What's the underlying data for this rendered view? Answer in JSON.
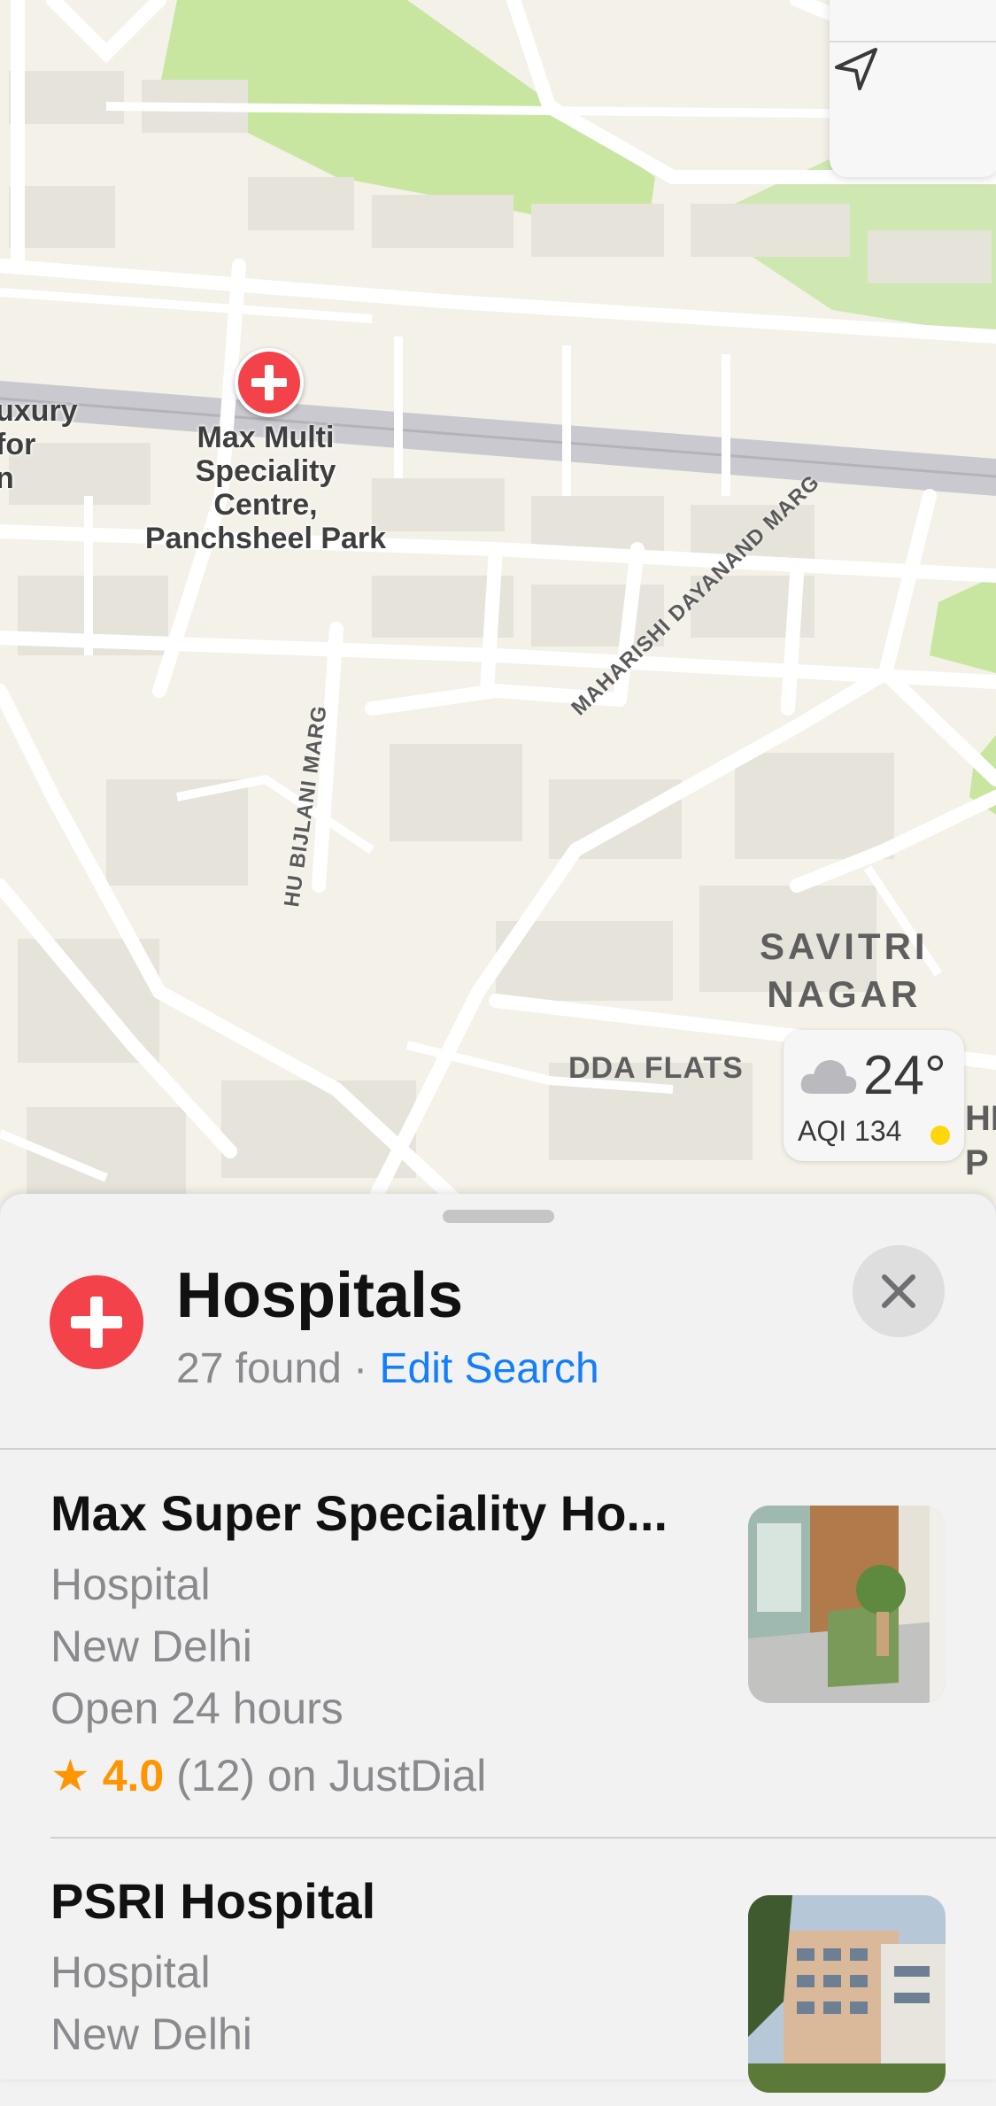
{
  "map": {
    "poi_name": "Max Multi\nSpeciality\nCentre,\nPanchsheel Park",
    "left_partial_label": "uxury\nfor\nn",
    "roads": {
      "road_1": "MAHARISHI DAYANAND MARG",
      "road_2": "HU BIJLANI MARG"
    },
    "area": {
      "savitri_nagar": "SAVITRI\nNAGAR",
      "dda_flats": "DDA FLATS",
      "edge_partial": "HE\nP"
    },
    "colors": {
      "land": "#f4f1e8",
      "park": "#c8e6a0",
      "road": "#ffffff",
      "building": "#e4e1da",
      "highway": "#c9c9cf"
    }
  },
  "controls": {
    "location_icon": "location-arrow-icon"
  },
  "weather": {
    "icon": "cloud-icon",
    "temperature": "24°",
    "aqi_label": "AQI 134",
    "aqi_dot_color": "#ffd60a"
  },
  "sheet": {
    "title": "Hospitals",
    "count_text": "27 found",
    "separator": " · ",
    "edit_search": "Edit Search",
    "category_icon": "hospital-cross-icon",
    "close_icon": "close-icon",
    "accent": "#147efb",
    "brand_red": "#f3424a"
  },
  "results": [
    {
      "name": "Max Super Speciality Ho...",
      "category": "Hospital",
      "city": "New Delhi",
      "hours": "Open 24 hours",
      "star": "★",
      "rating": "4.0",
      "reviews": "(12) on JustDial"
    },
    {
      "name": "PSRI Hospital",
      "category": "Hospital",
      "city": "New Delhi"
    }
  ]
}
